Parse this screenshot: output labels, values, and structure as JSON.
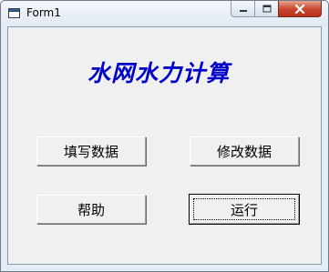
{
  "window": {
    "title": "Form1",
    "icons": {
      "app": "form-window-icon",
      "minimize": "minimize-icon",
      "maximize": "maximize-icon",
      "close": "close-icon"
    }
  },
  "main": {
    "heading": "水网水力计算",
    "heading_color": "#0000cc",
    "buttons": {
      "fill_data": "填写数据",
      "modify_data": "修改数据",
      "help": "帮助",
      "run": "运行"
    }
  }
}
